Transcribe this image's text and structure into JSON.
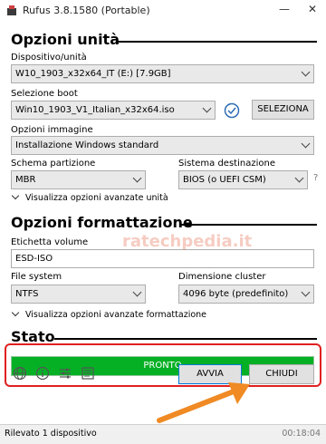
{
  "window": {
    "title": "Rufus 3.8.1580 (Portable)",
    "minimize": "—",
    "close": "✕"
  },
  "drive": {
    "section_title": "Opzioni unità",
    "device_label": "Dispositivo/unità",
    "device_value": "W10_1903_x32x64_IT (E:) [7.9GB]",
    "boot_label": "Selezione boot",
    "boot_value": "Win10_1903_V1_Italian_x32x64.iso",
    "select_button": "SELEZIONA",
    "image_label": "Opzioni immagine",
    "image_value": "Installazione Windows standard",
    "scheme_label": "Schema partizione",
    "scheme_value": "MBR",
    "target_label": "Sistema destinazione",
    "target_value": "BIOS (o UEFI CSM)",
    "help": "?",
    "advanced": "Visualizza opzioni avanzate unità"
  },
  "format": {
    "section_title": "Opzioni formattazione",
    "volume_label": "Etichetta volume",
    "volume_value": "ESD-ISO",
    "fs_label": "File system",
    "fs_value": "NTFS",
    "cluster_label": "Dimensione cluster",
    "cluster_value": "4096 byte (predefinito)",
    "advanced": "Visualizza opzioni avanzate formattazione"
  },
  "status": {
    "section_title": "Stato",
    "progress_text": "PRONTO",
    "progress": 1.0
  },
  "buttons": {
    "start": "AVVIA",
    "close": "CHIUDI"
  },
  "statusbar": {
    "text": "Rilevato 1 dispositivo",
    "time": "00:18:04"
  },
  "watermark": "ratechpedia.it",
  "colors": {
    "progress": "#06b025",
    "highlight": "#e02020",
    "arrow": "#f08a24"
  }
}
